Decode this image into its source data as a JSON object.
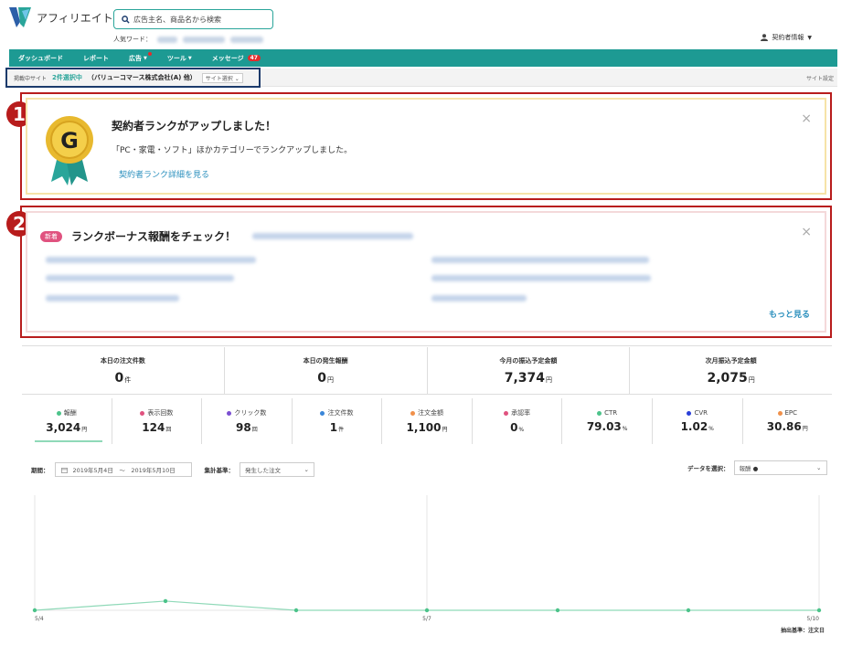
{
  "header": {
    "app_name": "アフィリエイト",
    "search_placeholder": "広告主名、商品名から検索",
    "popular_label": "人気ワード：",
    "user_label": "契約者情報"
  },
  "nav": {
    "items": [
      "ダッシュボード",
      "レポート",
      "広告",
      "ツール",
      "メッセージ"
    ],
    "message_count": "47"
  },
  "site_bar": {
    "label": "掲載中サイト",
    "selected": "2件選択中",
    "site_name": "（バリューコマース株式会社(A) 他）",
    "select_button": "サイト選択",
    "settings": "サイト設定"
  },
  "callouts": [
    "1",
    "2"
  ],
  "rank_card": {
    "badge_letter": "G",
    "title": "契約者ランクがアップしました！",
    "description": "「PC・家電・ソフト」ほかカテゴリーでランクアップしました。",
    "link": "契約者ランク詳細を見る"
  },
  "bonus_card": {
    "tag": "新着",
    "title": "ランクボーナス報酬をチェック！",
    "more": "もっと見る"
  },
  "summary": [
    {
      "label": "本日の注文件数",
      "value": "0",
      "unit": "件"
    },
    {
      "label": "本日の発生報酬",
      "value": "0",
      "unit": "円"
    },
    {
      "label": "今月の振込予定金額",
      "value": "7,374",
      "unit": "円"
    },
    {
      "label": "次月振込予定金額",
      "value": "2,075",
      "unit": "円"
    }
  ],
  "metrics": [
    {
      "label": "報酬",
      "value": "3,024",
      "unit": "円",
      "color": "#4cc38a"
    },
    {
      "label": "表示回数",
      "value": "124",
      "unit": "回",
      "color": "#e0527f"
    },
    {
      "label": "クリック数",
      "value": "98",
      "unit": "回",
      "color": "#7b4fd1"
    },
    {
      "label": "注文件数",
      "value": "1",
      "unit": "件",
      "color": "#3a86d8"
    },
    {
      "label": "注文金額",
      "value": "1,100",
      "unit": "円",
      "color": "#f0904a"
    },
    {
      "label": "承認率",
      "value": "0",
      "unit": "%",
      "color": "#e0527f"
    },
    {
      "label": "CTR",
      "value": "79.03",
      "unit": "%",
      "color": "#4cc38a"
    },
    {
      "label": "CVR",
      "value": "1.02",
      "unit": "%",
      "color": "#2a3fd8"
    },
    {
      "label": "EPC",
      "value": "30.86",
      "unit": "円",
      "color": "#f0904a"
    }
  ],
  "filters": {
    "period_label": "期間：",
    "period_value": "2019年5月4日　〜　2019年5月10日",
    "basis_label": "集計基準：",
    "basis_value": "発生した注文",
    "data_label": "データを選択：",
    "data_value": "報酬"
  },
  "chart_data": {
    "type": "line",
    "x": [
      "5/4",
      "5/5",
      "5/6",
      "5/7",
      "5/8",
      "5/9",
      "5/10"
    ],
    "x_tick_labels": [
      "5/4",
      "5/7",
      "5/10"
    ],
    "series": [
      {
        "values": [
          0,
          0.08,
          0,
          0,
          0,
          0,
          0
        ],
        "color": "#8fd9b8"
      }
    ],
    "footer_label": "抽出基準：注文日"
  }
}
